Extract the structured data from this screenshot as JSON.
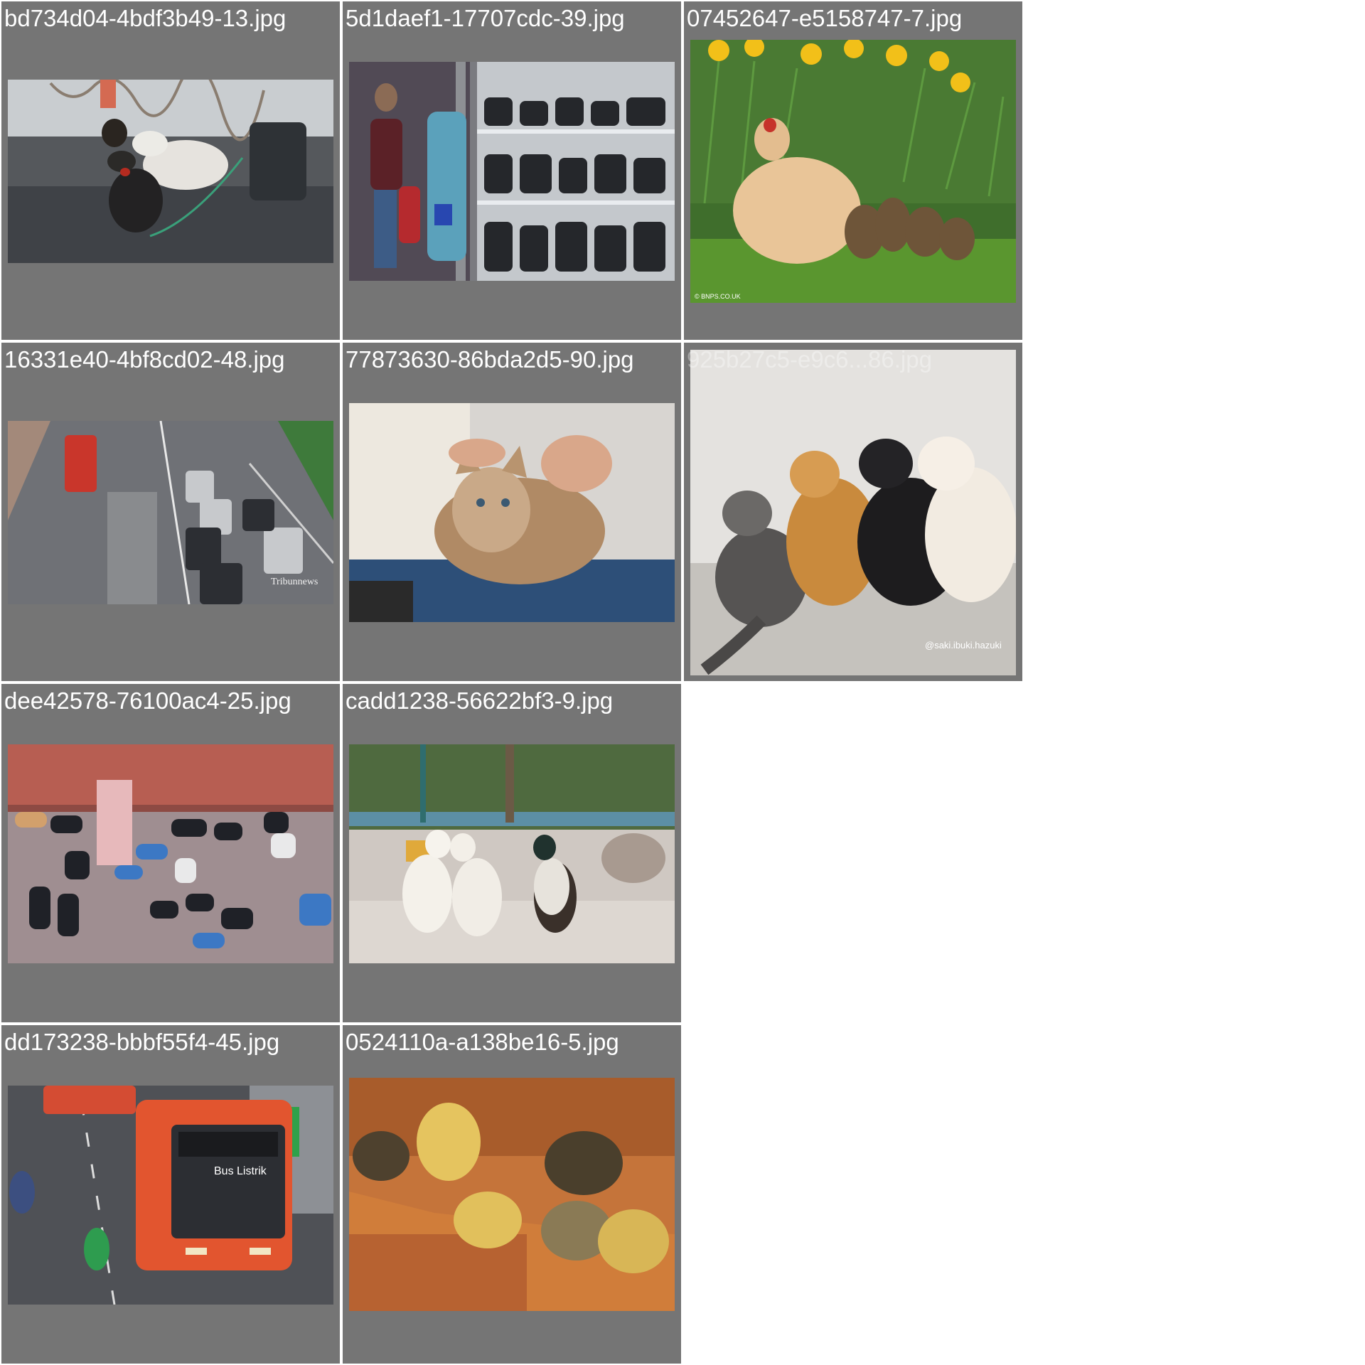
{
  "tiles": [
    {
      "filename": "bd734d04-4bdf3b49-13.jpg",
      "subject": "chickens on street"
    },
    {
      "filename": "5d1daef1-17707cdc-39.jpg",
      "subject": "sandal shop display"
    },
    {
      "filename": "07452647-e5158747-7.jpg",
      "subject": "hen with ducklings",
      "watermark": "© BNPS.CO.UK"
    },
    {
      "filename": "16331e40-4bf8cd02-48.jpg",
      "subject": "traffic road with bus",
      "watermark": "Tribunnews"
    },
    {
      "filename": "77873630-86bda2d5-90.jpg",
      "subject": "cat being petted"
    },
    {
      "filename": "925b27c5-e9c6...86.jpg",
      "subject": "cat and three dogs",
      "watermark": "@saki.ibuki.hazuki"
    },
    {
      "filename": "dee42578-76100ac4-25.jpg",
      "subject": "shoes on floor"
    },
    {
      "filename": "cadd1238-56622bf3-9.jpg",
      "subject": "three ducks on path"
    },
    {
      "filename": "dd173238-bbbf55f4-45.jpg",
      "subject": "electric bus on road",
      "bus_sign": "Bus Listrik"
    },
    {
      "filename": "0524110a-a138be16-5.jpg",
      "subject": "ducklings on brick wall"
    }
  ],
  "colors": {
    "tile_background": "#757575",
    "page_background": "#ffffff",
    "caption_text": "#ffffff"
  }
}
